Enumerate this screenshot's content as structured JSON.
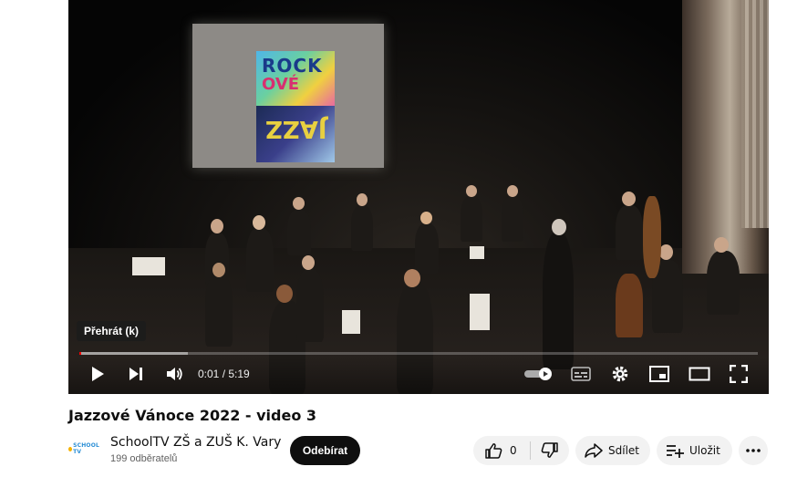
{
  "player": {
    "tooltip": "Přehrát (k)",
    "progress_played": 0.003,
    "progress_buffered": 0.16,
    "time_current": "0:01",
    "time_separator": " / ",
    "time_total": "5:19"
  },
  "video": {
    "title": "Jazzové Vánoce 2022 - video 3"
  },
  "channel": {
    "logo_text": "SCHOOL TV",
    "name": "SchoolTV ZŠ a ZUŠ K. Vary",
    "subscribers": "199 odběratelů",
    "subscribe_label": "Odebírat"
  },
  "actions": {
    "like_count": "0",
    "share_label": "Sdílet",
    "save_label": "Uložit"
  },
  "icons": [
    "play-icon",
    "next-icon",
    "volume-icon",
    "autoplay-toggle",
    "subtitles-icon",
    "settings-icon",
    "miniplayer-icon",
    "theater-icon",
    "fullscreen-icon",
    "thumbs-up-icon",
    "thumbs-down-icon",
    "share-icon",
    "playlist-add-icon",
    "more-icon"
  ],
  "colors": {
    "progress": "#ff0000",
    "subscribe_bg": "#0f0f0f",
    "pill_bg": "#f2f2f2"
  }
}
